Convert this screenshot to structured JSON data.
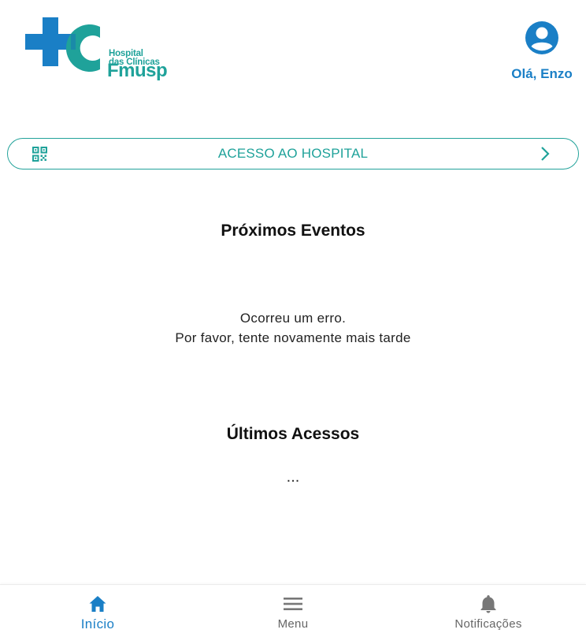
{
  "logo": {
    "line1": "Hospital",
    "line2": "das Clínicas",
    "brand": "Fmusp",
    "colors": {
      "blue": "#1a7fc6",
      "teal": "#1fa29a"
    }
  },
  "user": {
    "greeting": "Olá, Enzo",
    "icon": "account-circle-icon"
  },
  "access_button": {
    "label": "ACESSO AO HOSPITAL",
    "icon": "qr-code-icon",
    "trailing_icon": "chevron-right-icon"
  },
  "events": {
    "title": "Próximos Eventos",
    "error_line1": "Ocorreu um erro.",
    "error_line2": "Por favor, tente novamente mais tarde"
  },
  "accesses": {
    "title": "Últimos Acessos",
    "loading": "..."
  },
  "nav": {
    "items": [
      {
        "label": "Início",
        "icon": "home-icon",
        "active": true
      },
      {
        "label": "Menu",
        "icon": "menu-icon",
        "active": false
      },
      {
        "label": "Notificações",
        "icon": "bell-icon",
        "active": false
      }
    ]
  },
  "colors": {
    "accent_blue": "#1a7fc6",
    "accent_teal": "#1fa29a",
    "nav_inactive": "#666666"
  }
}
